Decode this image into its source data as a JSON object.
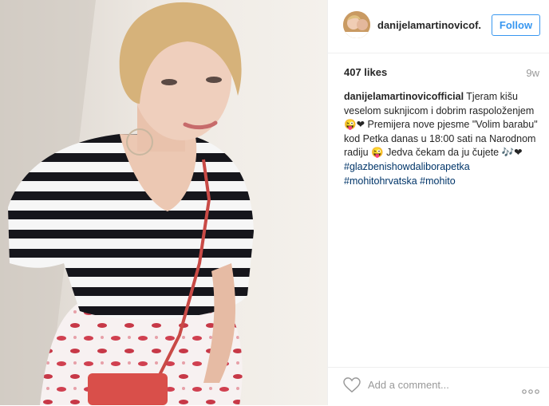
{
  "post": {
    "username": "danijelamartinovicof...",
    "follow_label": "Follow",
    "likes": "407 likes",
    "age": "9w",
    "caption": {
      "username": "danijelamartinovicofficial",
      "text": "Tjeram kišu veselom suknjicom i dobrim raspoloženjem 😜❤ Premijera nove pjesme \"Volim barabu\" kod Petka danas u 18:00 sati na Narodnom radiju 😜 Jedva čekam da ju čujete 🎶❤",
      "hashtag_line1": "#glazbenishowdaliborapetka",
      "hashtag_line2": "#mohitohrvatska #mohito"
    },
    "comment_placeholder": "Add a comment...",
    "icons": {
      "like": "heart-outline-icon",
      "more": "more-options-icon"
    },
    "colors": {
      "accent": "#3897f0",
      "hashtag": "#003569",
      "muted": "#999999"
    }
  }
}
